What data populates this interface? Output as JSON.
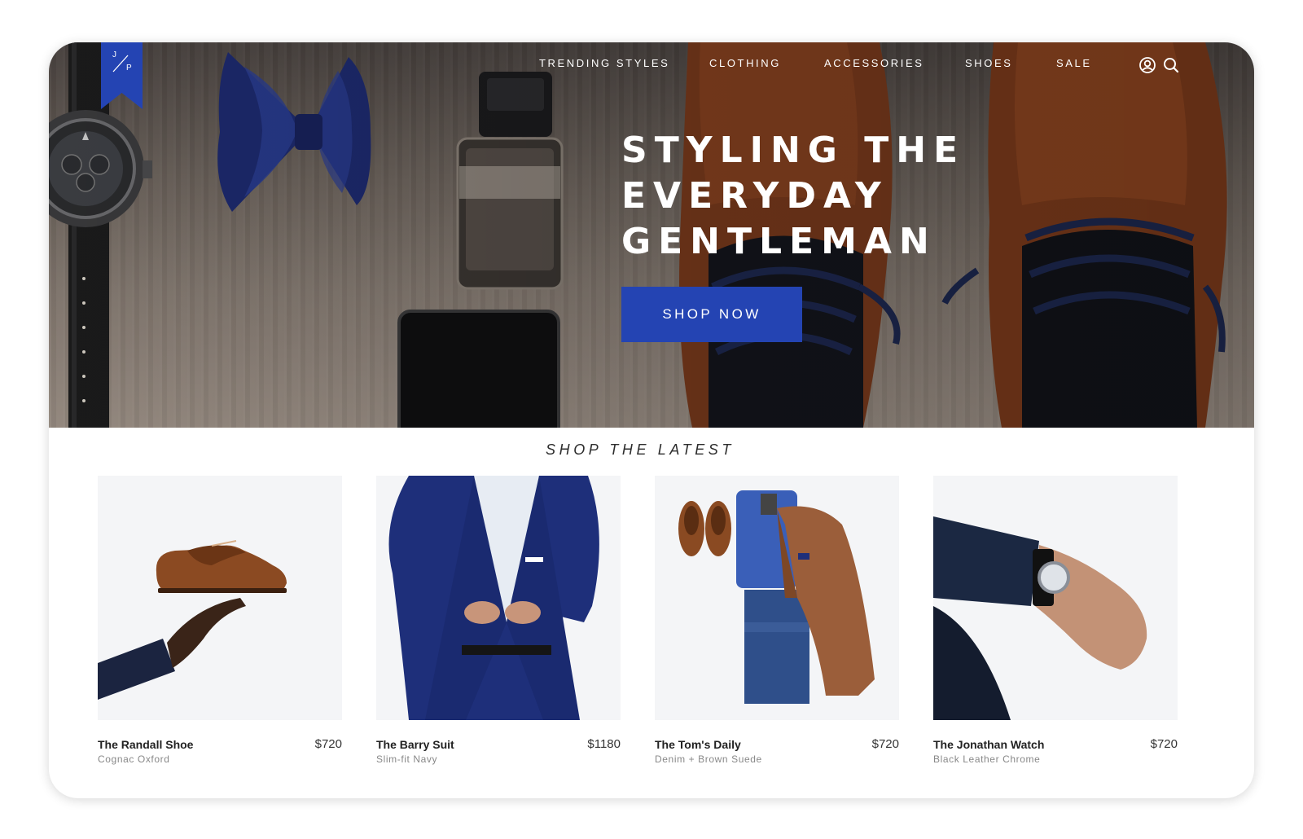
{
  "brand": {
    "logo_letters": [
      "J",
      "P"
    ]
  },
  "nav": {
    "items": [
      "TRENDING STYLES",
      "CLOTHING",
      "ACCESSORIES",
      "SHOES",
      "SALE"
    ],
    "icons": [
      "user-icon",
      "search-icon"
    ]
  },
  "hero": {
    "headline": [
      "STYLING THE",
      "EVERYDAY",
      "GENTLEMAN"
    ],
    "cta_label": "SHOP NOW"
  },
  "section": {
    "title": "SHOP THE LATEST"
  },
  "products": [
    {
      "name": "The Randall Shoe",
      "subtitle": "Cognac Oxford",
      "price": "$720"
    },
    {
      "name": "The Barry Suit",
      "subtitle": "Slim-fit Navy",
      "price": "$1180"
    },
    {
      "name": "The Tom's Daily",
      "subtitle": "Denim + Brown Suede",
      "price": "$720"
    },
    {
      "name": "The Jonathan Watch",
      "subtitle": "Black Leather Chrome",
      "price": "$720"
    }
  ],
  "colors": {
    "accent": "#2444b3",
    "card_bg": "#f4f5f7",
    "text": "#222222"
  }
}
